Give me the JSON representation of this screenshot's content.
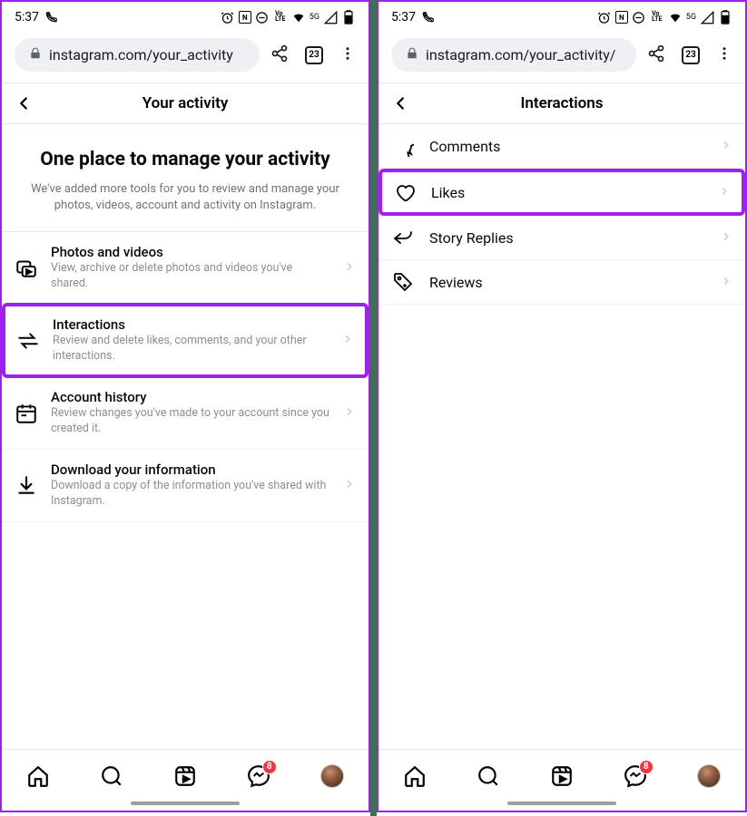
{
  "status": {
    "time": "5:37",
    "tab_count": "23",
    "badge_count": "8",
    "signal_text": "5G"
  },
  "left": {
    "url": "instagram.com/your_activity",
    "page_title": "Your activity",
    "intro_title": "One place to manage your activity",
    "intro_sub": "We've added more tools for you to review and manage your photos, videos, account and activity on Instagram.",
    "items": [
      {
        "title": "Photos and videos",
        "desc": "View, archive or delete photos and videos you've shared."
      },
      {
        "title": "Interactions",
        "desc": "Review and delete likes, comments, and your other interactions."
      },
      {
        "title": "Account history",
        "desc": "Review changes you've made to your account since you created it."
      },
      {
        "title": "Download your information",
        "desc": "Download a copy of the information you've shared with Instagram."
      }
    ]
  },
  "right": {
    "url": "instagram.com/your_activity/",
    "page_title": "Interactions",
    "items": [
      {
        "label": "Comments"
      },
      {
        "label": "Likes"
      },
      {
        "label": "Story Replies"
      },
      {
        "label": "Reviews"
      }
    ]
  }
}
